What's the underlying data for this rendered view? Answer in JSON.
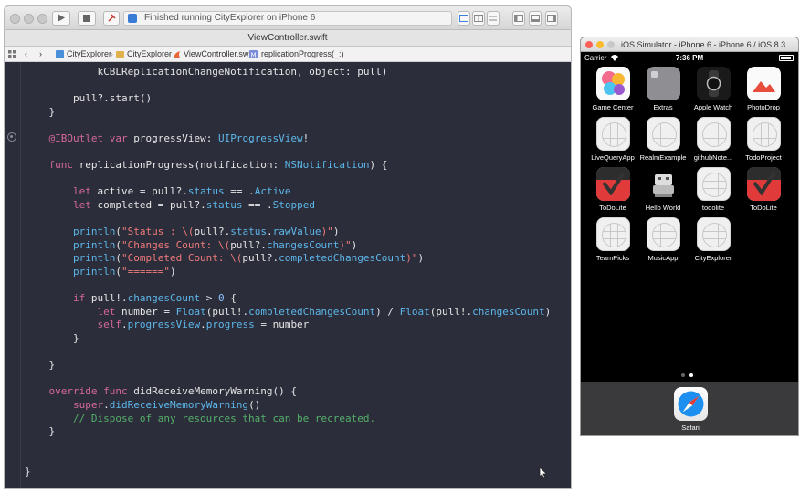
{
  "xcode": {
    "toolbar": {
      "status_message": "Finished running CityExplorer on iPhone 6"
    },
    "tab_title": "ViewController.swift",
    "jump_bar": [
      "CityExplorer",
      "CityExplorer",
      "ViewController.swift",
      "replicationProgress(_:)"
    ],
    "code_lines": [
      [
        {
          "t": "            kCBLReplicationChangeNotification, object: pull)",
          "c": ""
        }
      ],
      [
        {
          "t": "",
          "c": ""
        }
      ],
      [
        {
          "t": "        pull?.start()",
          "c": ""
        }
      ],
      [
        {
          "t": "    }",
          "c": ""
        }
      ],
      [
        {
          "t": "",
          "c": ""
        }
      ],
      [
        {
          "t": "    ",
          "c": ""
        },
        {
          "t": "@IBOutlet",
          "c": "kw"
        },
        {
          "t": " ",
          "c": ""
        },
        {
          "t": "var",
          "c": "kw"
        },
        {
          "t": " progressView: ",
          "c": ""
        },
        {
          "t": "UIProgressView",
          "c": "ty"
        },
        {
          "t": "!",
          "c": ""
        }
      ],
      [
        {
          "t": "",
          "c": ""
        }
      ],
      [
        {
          "t": "    ",
          "c": ""
        },
        {
          "t": "func",
          "c": "kw"
        },
        {
          "t": " replicationProgress(notification: ",
          "c": ""
        },
        {
          "t": "NSNotification",
          "c": "ty"
        },
        {
          "t": ") {",
          "c": ""
        }
      ],
      [
        {
          "t": "",
          "c": ""
        }
      ],
      [
        {
          "t": "        ",
          "c": ""
        },
        {
          "t": "let",
          "c": "kw"
        },
        {
          "t": " active = pull?.",
          "c": ""
        },
        {
          "t": "status",
          "c": "ty"
        },
        {
          "t": " == .",
          "c": ""
        },
        {
          "t": "Active",
          "c": "ty"
        }
      ],
      [
        {
          "t": "        ",
          "c": ""
        },
        {
          "t": "let",
          "c": "kw"
        },
        {
          "t": " completed = pull?.",
          "c": ""
        },
        {
          "t": "status",
          "c": "ty"
        },
        {
          "t": " == .",
          "c": ""
        },
        {
          "t": "Stopped",
          "c": "ty"
        }
      ],
      [
        {
          "t": "",
          "c": ""
        }
      ],
      [
        {
          "t": "        ",
          "c": ""
        },
        {
          "t": "println",
          "c": "ty"
        },
        {
          "t": "(",
          "c": ""
        },
        {
          "t": "\"Status : \\(",
          "c": "str"
        },
        {
          "t": "pull?.",
          "c": ""
        },
        {
          "t": "status",
          "c": "ty"
        },
        {
          "t": ".",
          "c": ""
        },
        {
          "t": "rawValue",
          "c": "ty"
        },
        {
          "t": ")\"",
          "c": "str"
        },
        {
          "t": ")",
          "c": ""
        }
      ],
      [
        {
          "t": "        ",
          "c": ""
        },
        {
          "t": "println",
          "c": "ty"
        },
        {
          "t": "(",
          "c": ""
        },
        {
          "t": "\"Changes Count: \\(",
          "c": "str"
        },
        {
          "t": "pull?.",
          "c": ""
        },
        {
          "t": "changesCount",
          "c": "ty"
        },
        {
          "t": ")\"",
          "c": "str"
        },
        {
          "t": ")",
          "c": ""
        }
      ],
      [
        {
          "t": "        ",
          "c": ""
        },
        {
          "t": "println",
          "c": "ty"
        },
        {
          "t": "(",
          "c": ""
        },
        {
          "t": "\"Completed Count: \\(",
          "c": "str"
        },
        {
          "t": "pull?.",
          "c": ""
        },
        {
          "t": "completedChangesCount",
          "c": "ty"
        },
        {
          "t": ")\"",
          "c": "str"
        },
        {
          "t": ")",
          "c": ""
        }
      ],
      [
        {
          "t": "        ",
          "c": ""
        },
        {
          "t": "println",
          "c": "ty"
        },
        {
          "t": "(",
          "c": ""
        },
        {
          "t": "\"======\"",
          "c": "str"
        },
        {
          "t": ")",
          "c": ""
        }
      ],
      [
        {
          "t": "",
          "c": ""
        }
      ],
      [
        {
          "t": "        ",
          "c": ""
        },
        {
          "t": "if",
          "c": "kw"
        },
        {
          "t": " pull!.",
          "c": ""
        },
        {
          "t": "changesCount",
          "c": "ty"
        },
        {
          "t": " > ",
          "c": ""
        },
        {
          "t": "0",
          "c": "num"
        },
        {
          "t": " {",
          "c": ""
        }
      ],
      [
        {
          "t": "            ",
          "c": ""
        },
        {
          "t": "let",
          "c": "kw"
        },
        {
          "t": " number = ",
          "c": ""
        },
        {
          "t": "Float",
          "c": "ty"
        },
        {
          "t": "(pull!.",
          "c": ""
        },
        {
          "t": "completedChangesCount",
          "c": "ty"
        },
        {
          "t": ") / ",
          "c": ""
        },
        {
          "t": "Float",
          "c": "ty"
        },
        {
          "t": "(pull!.",
          "c": ""
        },
        {
          "t": "changesCount",
          "c": "ty"
        },
        {
          "t": ")",
          "c": ""
        }
      ],
      [
        {
          "t": "            ",
          "c": ""
        },
        {
          "t": "self",
          "c": "kw"
        },
        {
          "t": ".",
          "c": ""
        },
        {
          "t": "progressView",
          "c": "ty"
        },
        {
          "t": ".",
          "c": ""
        },
        {
          "t": "progress",
          "c": "ty"
        },
        {
          "t": " = number",
          "c": ""
        }
      ],
      [
        {
          "t": "        }",
          "c": ""
        }
      ],
      [
        {
          "t": "",
          "c": ""
        }
      ],
      [
        {
          "t": "    }",
          "c": ""
        }
      ],
      [
        {
          "t": "",
          "c": ""
        }
      ],
      [
        {
          "t": "    ",
          "c": ""
        },
        {
          "t": "override",
          "c": "kw"
        },
        {
          "t": " ",
          "c": ""
        },
        {
          "t": "func",
          "c": "kw"
        },
        {
          "t": " didReceiveMemoryWarning() {",
          "c": ""
        }
      ],
      [
        {
          "t": "        ",
          "c": ""
        },
        {
          "t": "super",
          "c": "kw"
        },
        {
          "t": ".",
          "c": ""
        },
        {
          "t": "didReceiveMemoryWarning",
          "c": "ty"
        },
        {
          "t": "()",
          "c": ""
        }
      ],
      [
        {
          "t": "        // Dispose of any resources that can be recreated.",
          "c": "cm"
        }
      ],
      [
        {
          "t": "    }",
          "c": ""
        }
      ],
      [
        {
          "t": "",
          "c": ""
        }
      ],
      [
        {
          "t": "",
          "c": ""
        }
      ],
      [
        {
          "t": "}",
          "c": ""
        }
      ]
    ]
  },
  "simulator": {
    "title": "iOS Simulator - iPhone 6 - iPhone 6 / iOS 8.3...",
    "status_bar": {
      "carrier": "Carrier",
      "time": "7:36 PM"
    },
    "apps": [
      {
        "label": "Game Center",
        "icon": "game-center-icon",
        "style": "gamecenter"
      },
      {
        "label": "Extras",
        "icon": "extras-folder-icon",
        "style": "extras"
      },
      {
        "label": "Apple Watch",
        "icon": "apple-watch-icon",
        "style": "watch"
      },
      {
        "label": "PhotoDrop",
        "icon": "photodrop-icon",
        "style": "photodrop"
      },
      {
        "label": "LiveQueryApp",
        "icon": "placeholder-app-icon",
        "style": "placeholder"
      },
      {
        "label": "RealmExample",
        "icon": "placeholder-app-icon",
        "style": "placeholder"
      },
      {
        "label": "githubNote...",
        "icon": "placeholder-app-icon",
        "style": "placeholder"
      },
      {
        "label": "TodoProject",
        "icon": "placeholder-app-icon",
        "style": "placeholder"
      },
      {
        "label": "ToDoLite",
        "icon": "checkmark-icon",
        "style": "todolite"
      },
      {
        "label": "Hello World",
        "icon": "robot-icon",
        "style": "robot"
      },
      {
        "label": "todolite",
        "icon": "placeholder-app-icon",
        "style": "placeholder"
      },
      {
        "label": "ToDoLite",
        "icon": "checkmark-icon",
        "style": "todolite"
      },
      {
        "label": "TeamPicks",
        "icon": "placeholder-app-icon",
        "style": "placeholder"
      },
      {
        "label": "MusicApp",
        "icon": "placeholder-app-icon",
        "style": "placeholder"
      },
      {
        "label": "CityExplorer",
        "icon": "placeholder-app-icon",
        "style": "placeholder"
      }
    ],
    "page_count": 2,
    "current_page": 2,
    "dock": [
      {
        "label": "Safari",
        "icon": "safari-icon"
      }
    ]
  }
}
